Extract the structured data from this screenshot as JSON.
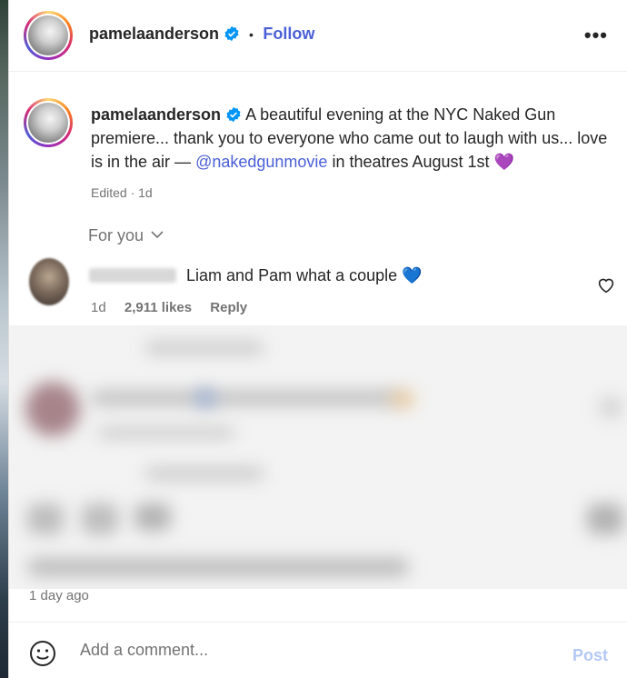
{
  "post": {
    "username": "pamelaanderson",
    "follow_label": "Follow",
    "separator": "•",
    "more_icon": "more-horizontal-icon",
    "caption_text": "A beautiful evening at the NYC Naked Gun premiere... thank you to everyone who came out to laugh with us... love is in the air —",
    "caption_mention": "@nakedgunmovie",
    "caption_tail": "in theatres August 1st",
    "caption_emoji": "💜",
    "edited": "Edited · 1d"
  },
  "comments": {
    "filter_label": "For you",
    "first": {
      "text": "Liam and Pam what a couple",
      "emoji": "💙",
      "age": "1d",
      "likes": "2,911 likes",
      "reply_label": "Reply"
    }
  },
  "footer": {
    "time": "1 day ago",
    "placeholder": "Add a comment...",
    "post_label": "Post"
  },
  "colors": {
    "accent": "#4a5fd6",
    "verified": "#0095f6",
    "muted": "#737373"
  }
}
